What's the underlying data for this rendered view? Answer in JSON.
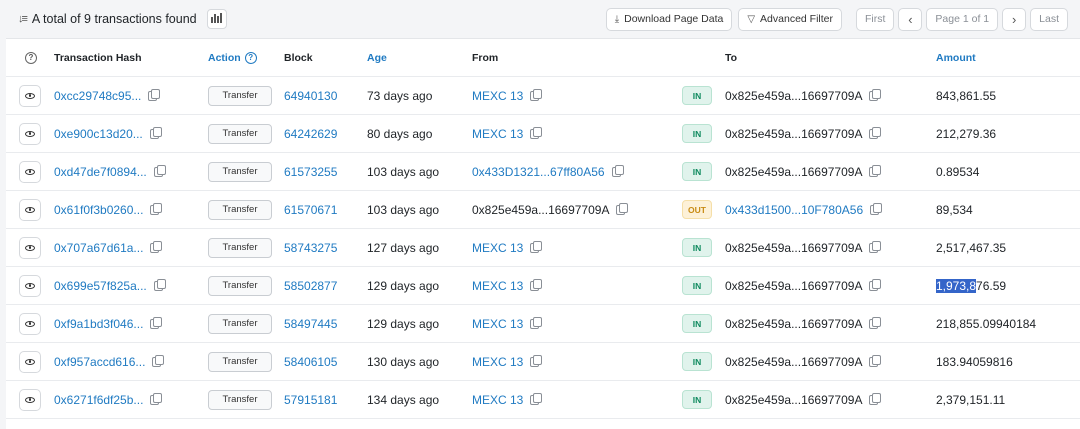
{
  "summary": {
    "text": "A total of 9 transactions found"
  },
  "toolbar": {
    "download": "Download Page Data",
    "filter": "Advanced Filter"
  },
  "pager": {
    "first": "First",
    "prev": "‹",
    "page": "Page 1 of 1",
    "next": "›",
    "last": "Last"
  },
  "columns": {
    "hash": "Transaction Hash",
    "action": "Action",
    "block": "Block",
    "age": "Age",
    "from": "From",
    "to": "To",
    "amount": "Amount"
  },
  "rows": [
    {
      "hash": "0xcc29748c95...",
      "action": "Transfer",
      "block": "64940130",
      "age": "73 days ago",
      "from": "MEXC 13",
      "dir": "IN",
      "to": "0x825e459a...16697709A",
      "amount": "843,861.55"
    },
    {
      "hash": "0xe900c13d20...",
      "action": "Transfer",
      "block": "64242629",
      "age": "80 days ago",
      "from": "MEXC 13",
      "dir": "IN",
      "to": "0x825e459a...16697709A",
      "amount": "212,279.36"
    },
    {
      "hash": "0xd47de7f0894...",
      "action": "Transfer",
      "block": "61573255",
      "age": "103 days ago",
      "from": "0x433D1321...67ff80A56",
      "dir": "IN",
      "to": "0x825e459a...16697709A",
      "amount": "0.89534"
    },
    {
      "hash": "0x61f0f3b0260...",
      "action": "Transfer",
      "block": "61570671",
      "age": "103 days ago",
      "from": "0x825e459a...16697709A",
      "dir": "OUT",
      "to": "0x433d1500...10F780A56",
      "amount": "89,534"
    },
    {
      "hash": "0x707a67d61a...",
      "action": "Transfer",
      "block": "58743275",
      "age": "127 days ago",
      "from": "MEXC 13",
      "dir": "IN",
      "to": "0x825e459a...16697709A",
      "amount": "2,517,467.35"
    },
    {
      "hash": "0x699e57f825a...",
      "action": "Transfer",
      "block": "58502877",
      "age": "129 days ago",
      "from": "MEXC 13",
      "dir": "IN",
      "to": "0x825e459a...16697709A",
      "amount_hl": "1,973,8",
      "amount_rest": "76.59"
    },
    {
      "hash": "0xf9a1bd3f046...",
      "action": "Transfer",
      "block": "58497445",
      "age": "129 days ago",
      "from": "MEXC 13",
      "dir": "IN",
      "to": "0x825e459a...16697709A",
      "amount": "218,855.09940184"
    },
    {
      "hash": "0xf957accd616...",
      "action": "Transfer",
      "block": "58406105",
      "age": "130 days ago",
      "from": "MEXC 13",
      "dir": "IN",
      "to": "0x825e459a...16697709A",
      "amount": "183.94059816"
    },
    {
      "hash": "0x6271f6df25b...",
      "action": "Transfer",
      "block": "57915181",
      "age": "134 days ago",
      "from": "MEXC 13",
      "dir": "IN",
      "to": "0x825e459a...16697709A",
      "amount": "2,379,151.11"
    }
  ]
}
